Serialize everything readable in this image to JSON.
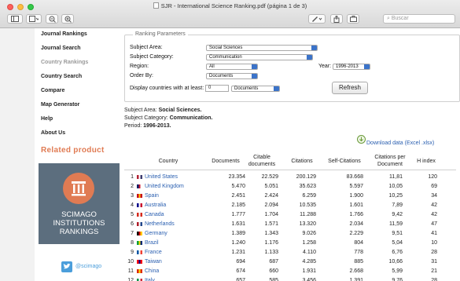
{
  "window": {
    "title": "SJR - International Science Ranking.pdf (página 1 de 3)"
  },
  "toolbar": {
    "search_placeholder": "Buscar",
    "icons": [
      "sidebar-toggle-icon",
      "zoom-out-icon",
      "zoom-in-icon",
      "annotate-pen-icon",
      "share-icon",
      "toolbox-icon"
    ]
  },
  "sidebar": {
    "items": [
      {
        "label": "Journal Rankings"
      },
      {
        "label": "Journal Search"
      },
      {
        "label": "Country Rankings"
      },
      {
        "label": "Country Search"
      },
      {
        "label": "Compare"
      },
      {
        "label": "Map Generator"
      },
      {
        "label": "Help"
      },
      {
        "label": "About Us"
      }
    ],
    "active_index": 2,
    "related_heading": "Related product",
    "logo_lines": [
      "SCIMAGO",
      "INSTITUTIONS",
      "RANKINGS"
    ],
    "twitter_label": "@scimago"
  },
  "params": {
    "legend": "Ranking Parameters",
    "subject_area_label": "Subject Area:",
    "subject_area_value": "Social Sciences",
    "subject_category_label": "Subject Category:",
    "subject_category_value": "Communication",
    "region_label": "Region:",
    "region_value": "All",
    "year_label": "Year:",
    "year_value": "1996-2013",
    "order_by_label": "Order By:",
    "order_by_value": "Documents",
    "display_label": "Display countries with at least:",
    "display_count": "0",
    "display_unit": "Documents",
    "refresh_label": "Refresh"
  },
  "summary": {
    "area_label": "Subject Area:",
    "area_value": "Social Sciences.",
    "category_label": "Subject Category:",
    "category_value": "Communication.",
    "period_label": "Period:",
    "period_value": "1996-2013."
  },
  "download_label": "Download data (Excel .xlsx)",
  "table": {
    "headers": [
      "Country",
      "Documents",
      "Citable documents",
      "Citations",
      "Self-Citations",
      "Citations per Document",
      "H index"
    ],
    "rows": [
      {
        "rank": "1",
        "country": "United States",
        "documents": "23.354",
        "citable": "22.529",
        "citations": "200.129",
        "self": "83.668",
        "cpd": "11,81",
        "h": "120"
      },
      {
        "rank": "2",
        "country": "United Kingdom",
        "documents": "5.470",
        "citable": "5.051",
        "citations": "35.623",
        "self": "5.597",
        "cpd": "10,05",
        "h": "69"
      },
      {
        "rank": "3",
        "country": "Spain",
        "documents": "2.451",
        "citable": "2.424",
        "citations": "6.259",
        "self": "1.900",
        "cpd": "10,25",
        "h": "34"
      },
      {
        "rank": "4",
        "country": "Australia",
        "documents": "2.185",
        "citable": "2.094",
        "citations": "10.535",
        "self": "1.601",
        "cpd": "7,89",
        "h": "42"
      },
      {
        "rank": "5",
        "country": "Canada",
        "documents": "1.777",
        "citable": "1.704",
        "citations": "11.288",
        "self": "1.766",
        "cpd": "9,42",
        "h": "42"
      },
      {
        "rank": "6",
        "country": "Netherlands",
        "documents": "1.631",
        "citable": "1.571",
        "citations": "13.320",
        "self": "2.034",
        "cpd": "11,59",
        "h": "47"
      },
      {
        "rank": "7",
        "country": "Germany",
        "documents": "1.389",
        "citable": "1.343",
        "citations": "9.026",
        "self": "2.229",
        "cpd": "9,51",
        "h": "41"
      },
      {
        "rank": "8",
        "country": "Brazil",
        "documents": "1.240",
        "citable": "1.176",
        "citations": "1.258",
        "self": "804",
        "cpd": "5,04",
        "h": "10"
      },
      {
        "rank": "9",
        "country": "France",
        "documents": "1.231",
        "citable": "1.133",
        "citations": "4.110",
        "self": "778",
        "cpd": "6,76",
        "h": "28"
      },
      {
        "rank": "10",
        "country": "Taiwan",
        "documents": "694",
        "citable": "687",
        "citations": "4.285",
        "self": "885",
        "cpd": "10,66",
        "h": "31"
      },
      {
        "rank": "11",
        "country": "China",
        "documents": "674",
        "citable": "660",
        "citations": "1.931",
        "self": "2.668",
        "cpd": "5,99",
        "h": "21"
      },
      {
        "rank": "12",
        "country": "Italy",
        "documents": "657",
        "citable": "585",
        "citations": "3.456",
        "self": "1.391",
        "cpd": "9,76",
        "h": "28"
      }
    ]
  }
}
